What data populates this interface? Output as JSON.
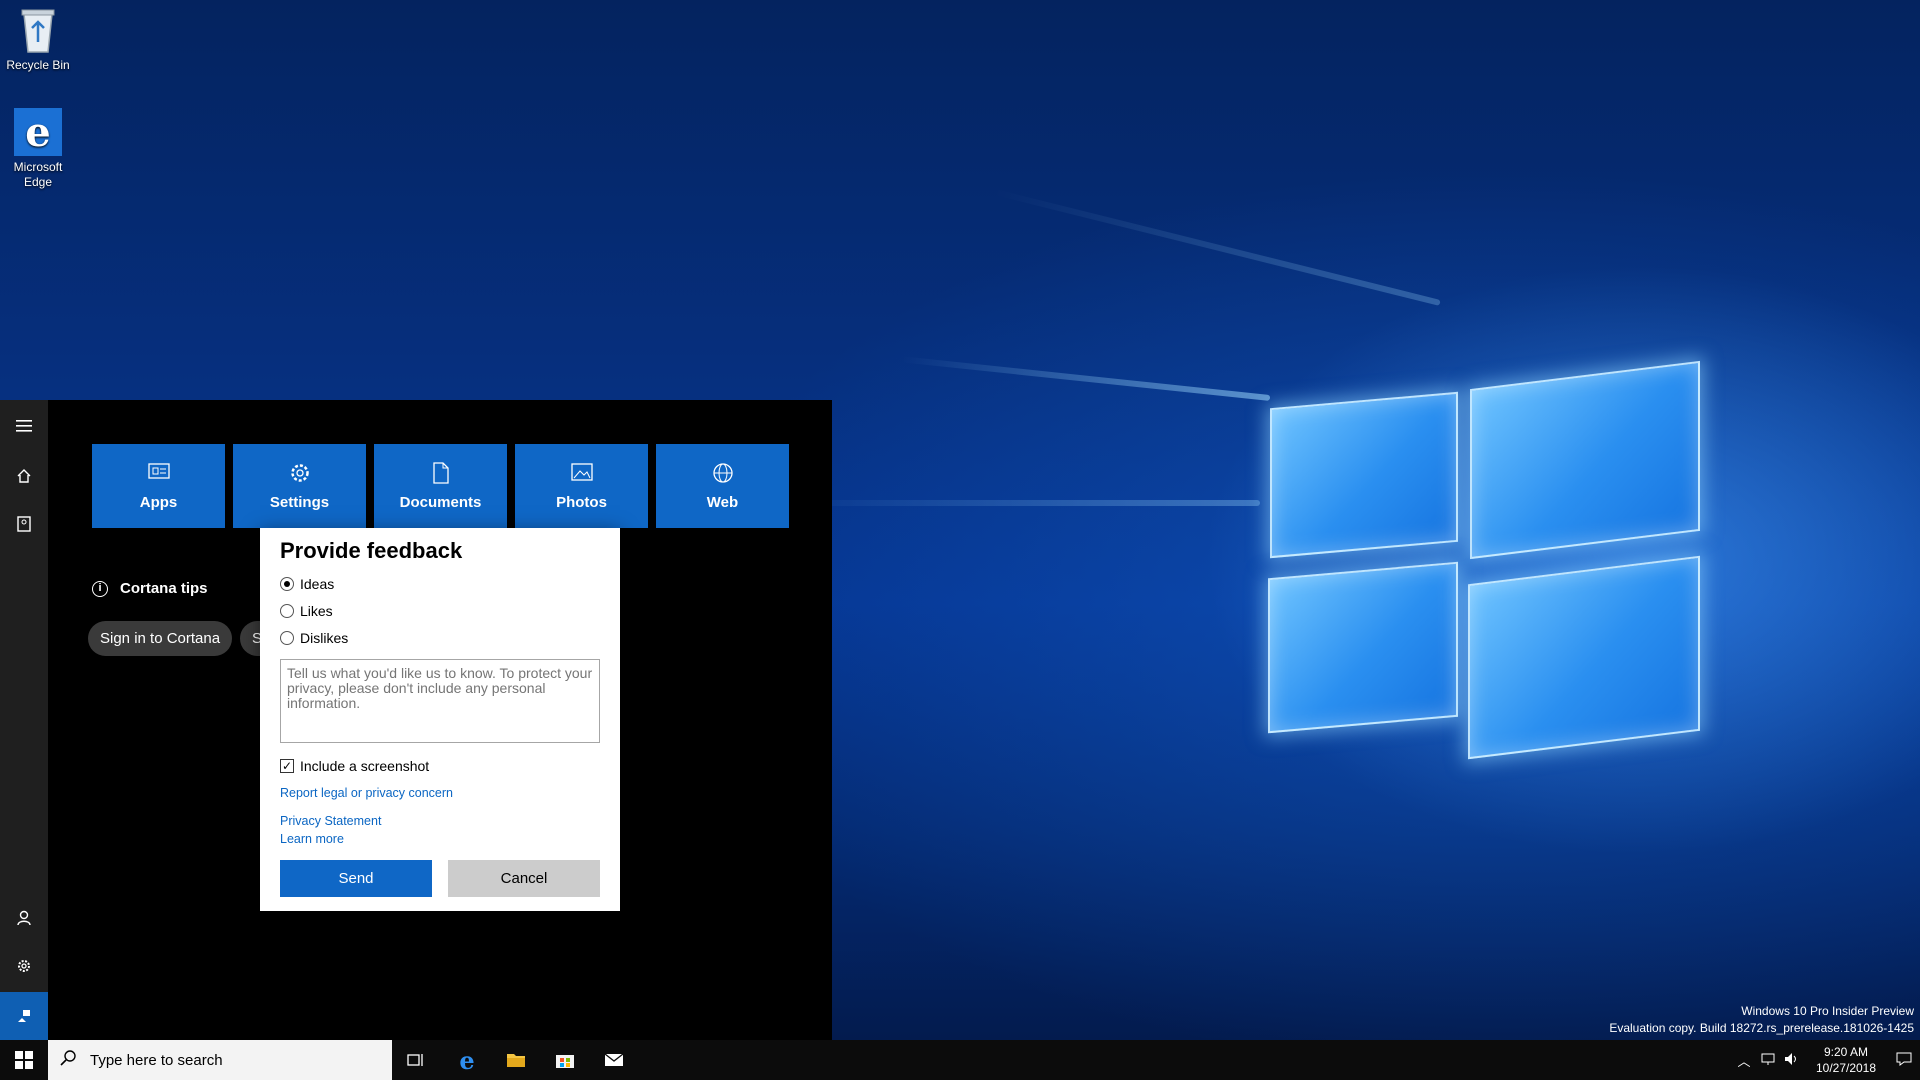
{
  "desktop": {
    "icons": [
      {
        "label": "Recycle Bin",
        "icon": "recycle-bin-icon"
      },
      {
        "label": "Microsoft Edge",
        "icon": "edge-icon"
      }
    ]
  },
  "search_panel": {
    "rail": [
      "hamburger-menu-icon",
      "home-icon",
      "notebook-icon",
      "account-icon",
      "settings-icon",
      "feedback-icon"
    ],
    "tiles": [
      {
        "label": "Apps",
        "icon": "apps-icon"
      },
      {
        "label": "Settings",
        "icon": "gear-icon"
      },
      {
        "label": "Documents",
        "icon": "document-icon"
      },
      {
        "label": "Photos",
        "icon": "photo-icon"
      },
      {
        "label": "Web",
        "icon": "globe-icon"
      }
    ],
    "tips_title": "Cortana tips",
    "chips": [
      "Sign in to Cortana",
      "S"
    ]
  },
  "feedback_dialog": {
    "title": "Provide feedback",
    "options": [
      {
        "label": "Ideas",
        "selected": true
      },
      {
        "label": "Likes",
        "selected": false
      },
      {
        "label": "Dislikes",
        "selected": false
      }
    ],
    "placeholder": "Tell us what you'd like us to know. To protect your privacy, please don't include any personal information.",
    "include_screenshot_label": "Include a screenshot",
    "include_screenshot_checked": true,
    "links": {
      "report": "Report legal or privacy concern",
      "privacy": "Privacy Statement",
      "learn": "Learn more"
    },
    "send_label": "Send",
    "cancel_label": "Cancel"
  },
  "taskbar": {
    "search_placeholder": "Type here to search",
    "clock_time": "9:20 AM",
    "clock_date": "10/27/2018"
  },
  "watermark": {
    "line1": "Windows 10 Pro Insider Preview",
    "line2": "Evaluation copy. Build 18272.rs_prerelease.181026-1425"
  },
  "colors": {
    "accent": "#0f67c6",
    "panel_bg": "#000000",
    "rail_bg": "#1f1f1f",
    "link": "#0b66c3"
  }
}
